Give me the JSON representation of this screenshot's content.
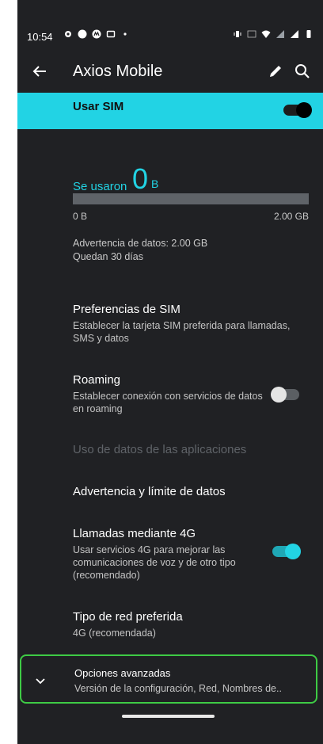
{
  "status_bar": {
    "time": "10:54",
    "icons_left": [
      "settings-icon",
      "game-controller-icon",
      "motorola-icon",
      "cast-icon",
      "dot-icon"
    ],
    "icons_right": [
      "vibrate-icon",
      "volte-icon",
      "wifi-icon",
      "signal-4g-icon",
      "signal-icon",
      "battery-icon"
    ]
  },
  "app_bar": {
    "title": "Axios Mobile",
    "back_icon": "arrow-left-icon",
    "edit_icon": "pencil-icon",
    "search_icon": "search-icon"
  },
  "sim": {
    "label": "Usar SIM",
    "enabled": true,
    "color": "#22d3e4"
  },
  "usage": {
    "used_label": "Se usaron",
    "used_value": "0",
    "used_unit": "B",
    "bar_fraction": 0.0,
    "bar_min": "0 B",
    "bar_max": "2.00 GB",
    "warning": "Advertencia de datos: 2.00 GB",
    "days_left": "Quedan 30 días"
  },
  "items": {
    "sim_prefs": {
      "title": "Preferencias de SIM",
      "sub": "Establecer la tarjeta SIM preferida para llamadas, SMS y datos"
    },
    "roaming": {
      "title": "Roaming",
      "sub": "Establecer conexión con servicios de datos en roaming",
      "enabled": false
    },
    "app_usage": {
      "title": "Uso de datos de las aplicaciones"
    },
    "data_warning": {
      "title": "Advertencia y límite de datos"
    },
    "lte_calls": {
      "title": "Llamadas mediante 4G",
      "sub": "Usar servicios 4G para mejorar las comunicaciones de voz y de otro tipo (recomendado)",
      "enabled": true
    },
    "network_type": {
      "title": "Tipo de red preferida",
      "sub": "4G (recomendada)"
    },
    "advanced": {
      "title": "Opciones avanzadas",
      "sub": "Versión de la configuración, Red, Nombres de.."
    }
  },
  "colors": {
    "background": "#202124",
    "accent": "#22d3e4",
    "highlight_border": "#3ecb45"
  }
}
